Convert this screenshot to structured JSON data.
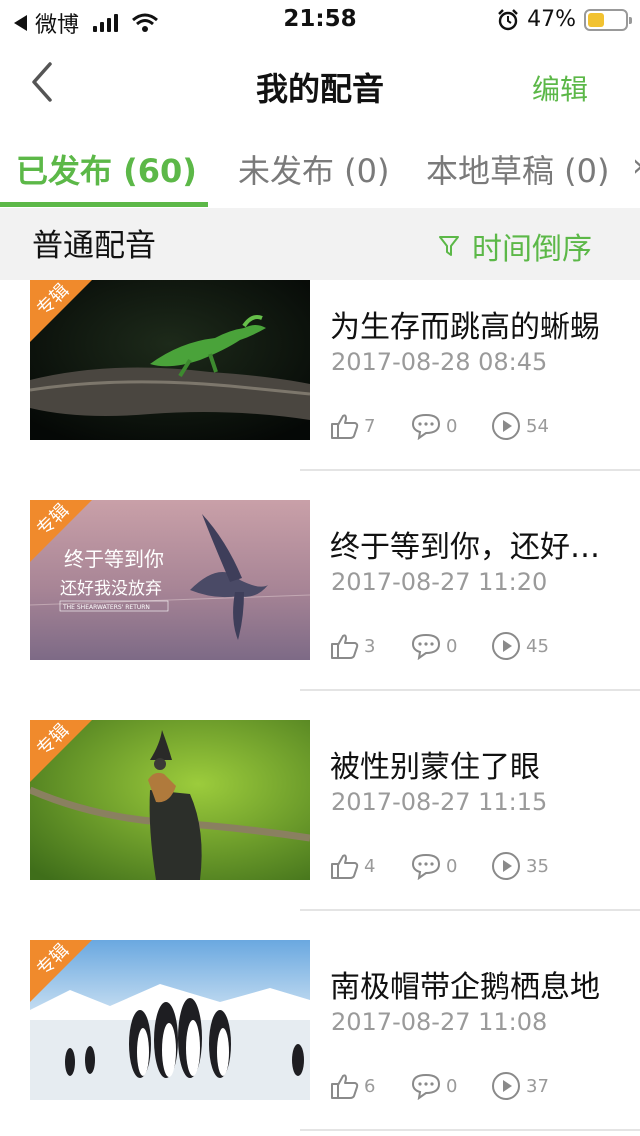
{
  "status_bar": {
    "back_app": "微博",
    "time": "21:58",
    "battery": "47%",
    "battery_level": 0.47
  },
  "nav": {
    "title": "我的配音",
    "edit_label": "编辑"
  },
  "tabs": [
    {
      "label": "已发布 (60)",
      "active": true
    },
    {
      "label": "未发布 (0)",
      "active": false
    },
    {
      "label": "本地草稿 (0)",
      "active": false
    }
  ],
  "section": {
    "title": "普通配音",
    "sort_label": "时间倒序"
  },
  "badge_label": "专辑",
  "thumb_texts": {
    "line1": "终于等到你",
    "line2": "还好我没放弃",
    "line3": "THE SHEARWATERS' RETURN"
  },
  "items": [
    {
      "title": "为生存而跳高的蜥蜴",
      "date": "2017-08-28 08:45",
      "likes": "7",
      "comments": "0",
      "plays": "54",
      "image": "lizard-on-log"
    },
    {
      "title": "终于等到你，还好…",
      "date": "2017-08-27 11:20",
      "likes": "3",
      "comments": "0",
      "plays": "45",
      "image": "shearwater-flying"
    },
    {
      "title": "被性别蒙住了眼",
      "date": "2017-08-27 11:15",
      "likes": "4",
      "comments": "0",
      "plays": "35",
      "image": "crested-bird-on-branch"
    },
    {
      "title": "南极帽带企鹅栖息地",
      "date": "2017-08-27 11:08",
      "likes": "6",
      "comments": "0",
      "plays": "37",
      "image": "penguins-on-ice"
    }
  ],
  "colors": {
    "accent": "#5cb848",
    "badge": "#f08a2c",
    "muted": "#9a9a9a"
  }
}
